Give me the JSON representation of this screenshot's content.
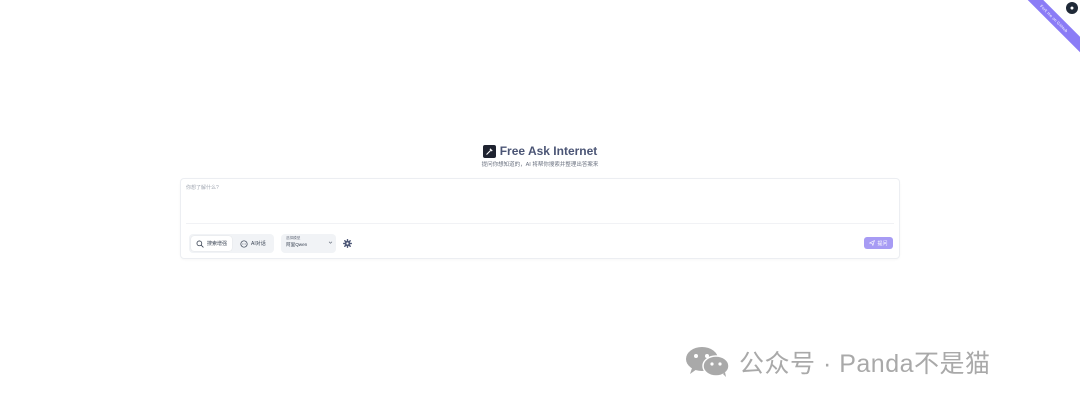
{
  "corner_ribbon": {
    "label": "Fork me on GitHub"
  },
  "header": {
    "logo_icon": "hammer-icon",
    "title": "Free Ask Internet",
    "subtitle": "提问你想知道的，AI 将帮你搜索并整理出答案来"
  },
  "query": {
    "placeholder": "你想了解什么?",
    "value": ""
  },
  "modes": [
    {
      "label": "搜索增强",
      "icon": "search-icon",
      "active": true
    },
    {
      "label": "AI对话",
      "icon": "chat-bubble-icon",
      "active": false
    }
  ],
  "model": {
    "label": "选择模型",
    "value": "阿里Qwen"
  },
  "settings": {
    "icon": "gear-icon"
  },
  "submit": {
    "label": "提问",
    "icon": "send-icon"
  },
  "watermark": {
    "text": "公众号 · Panda不是猫",
    "icon": "wechat-icon"
  },
  "colors": {
    "accent": "#a79bf4",
    "ribbon": "#8b7cf6",
    "title": "#4b5575"
  }
}
